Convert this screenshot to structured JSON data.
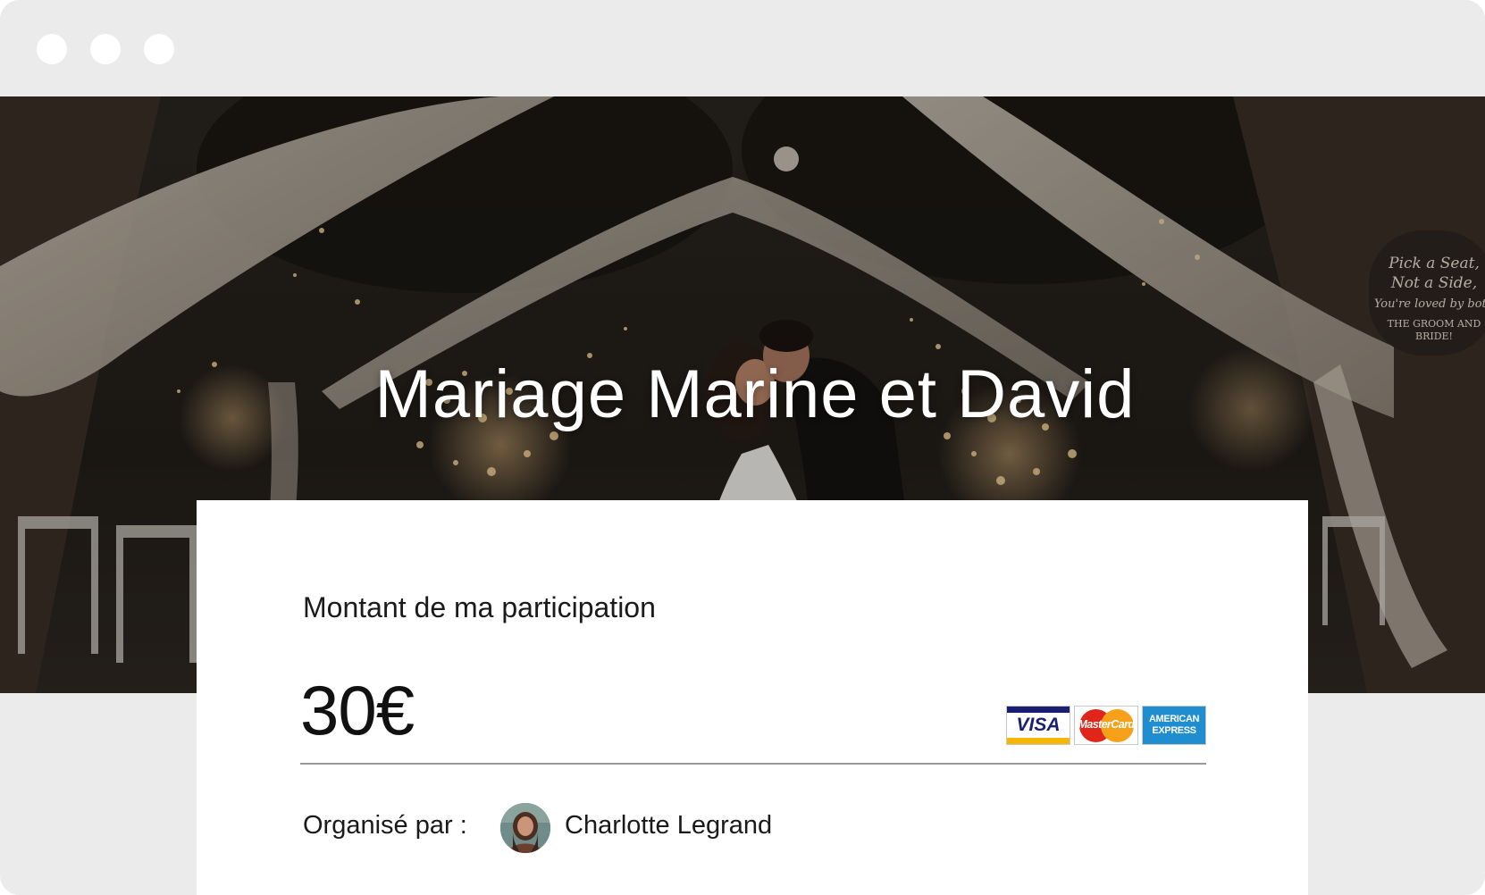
{
  "window": {
    "controls": [
      "window-dot",
      "window-dot",
      "window-dot"
    ]
  },
  "hero": {
    "title": "Mariage Marine et David",
    "sign_lines": [
      "Pick a Seat,",
      "Not a Side,",
      "You're loved by both",
      "THE GROOM AND",
      "BRIDE!"
    ]
  },
  "contribution": {
    "label": "Montant de ma participation",
    "amount": "30€",
    "payment_methods": [
      {
        "name": "visa-logo",
        "label": "VISA"
      },
      {
        "name": "mastercard-logo",
        "label": "MasterCard"
      },
      {
        "name": "amex-logo",
        "label_line1": "AMERICAN",
        "label_line2": "EXPRESS"
      }
    ]
  },
  "organizer": {
    "label": "Organisé par :",
    "name": "Charlotte Legrand",
    "avatar_icon": "avatar-photo"
  },
  "colors": {
    "chrome": "#ebebeb",
    "card": "#ffffff",
    "text": "#1a1a1a",
    "divider": "#9a9a9a"
  }
}
